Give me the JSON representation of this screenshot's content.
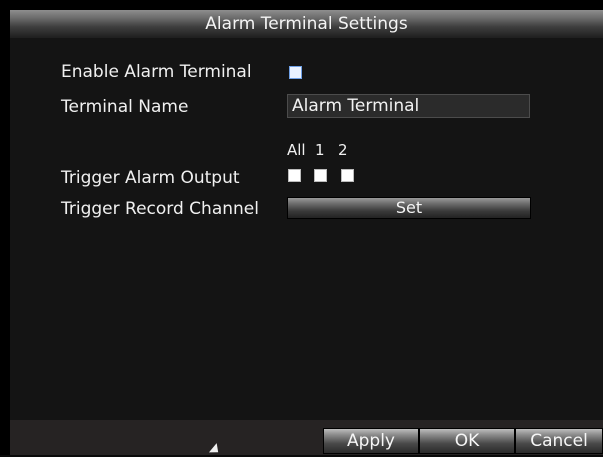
{
  "window": {
    "title": "Alarm Terminal Settings"
  },
  "settings": {
    "enable_label": "Enable Alarm Terminal",
    "enable_checked": false,
    "name_label": "Terminal Name",
    "name_value": "Alarm Terminal",
    "trigger_output_label": "Trigger Alarm Output",
    "output_headers": [
      "All",
      "1",
      "2"
    ],
    "trigger_record_label": "Trigger Record Channel",
    "set_button": "Set"
  },
  "footer": {
    "apply": "Apply",
    "ok": "OK",
    "cancel": "Cancel"
  },
  "colors": {
    "background": "#0a0a0a",
    "panel": "#141414",
    "text": "#f0f0f0",
    "checkbox_accent": "#6fa0e6"
  },
  "icons": {
    "cursor": "mouse-pointer-icon"
  }
}
